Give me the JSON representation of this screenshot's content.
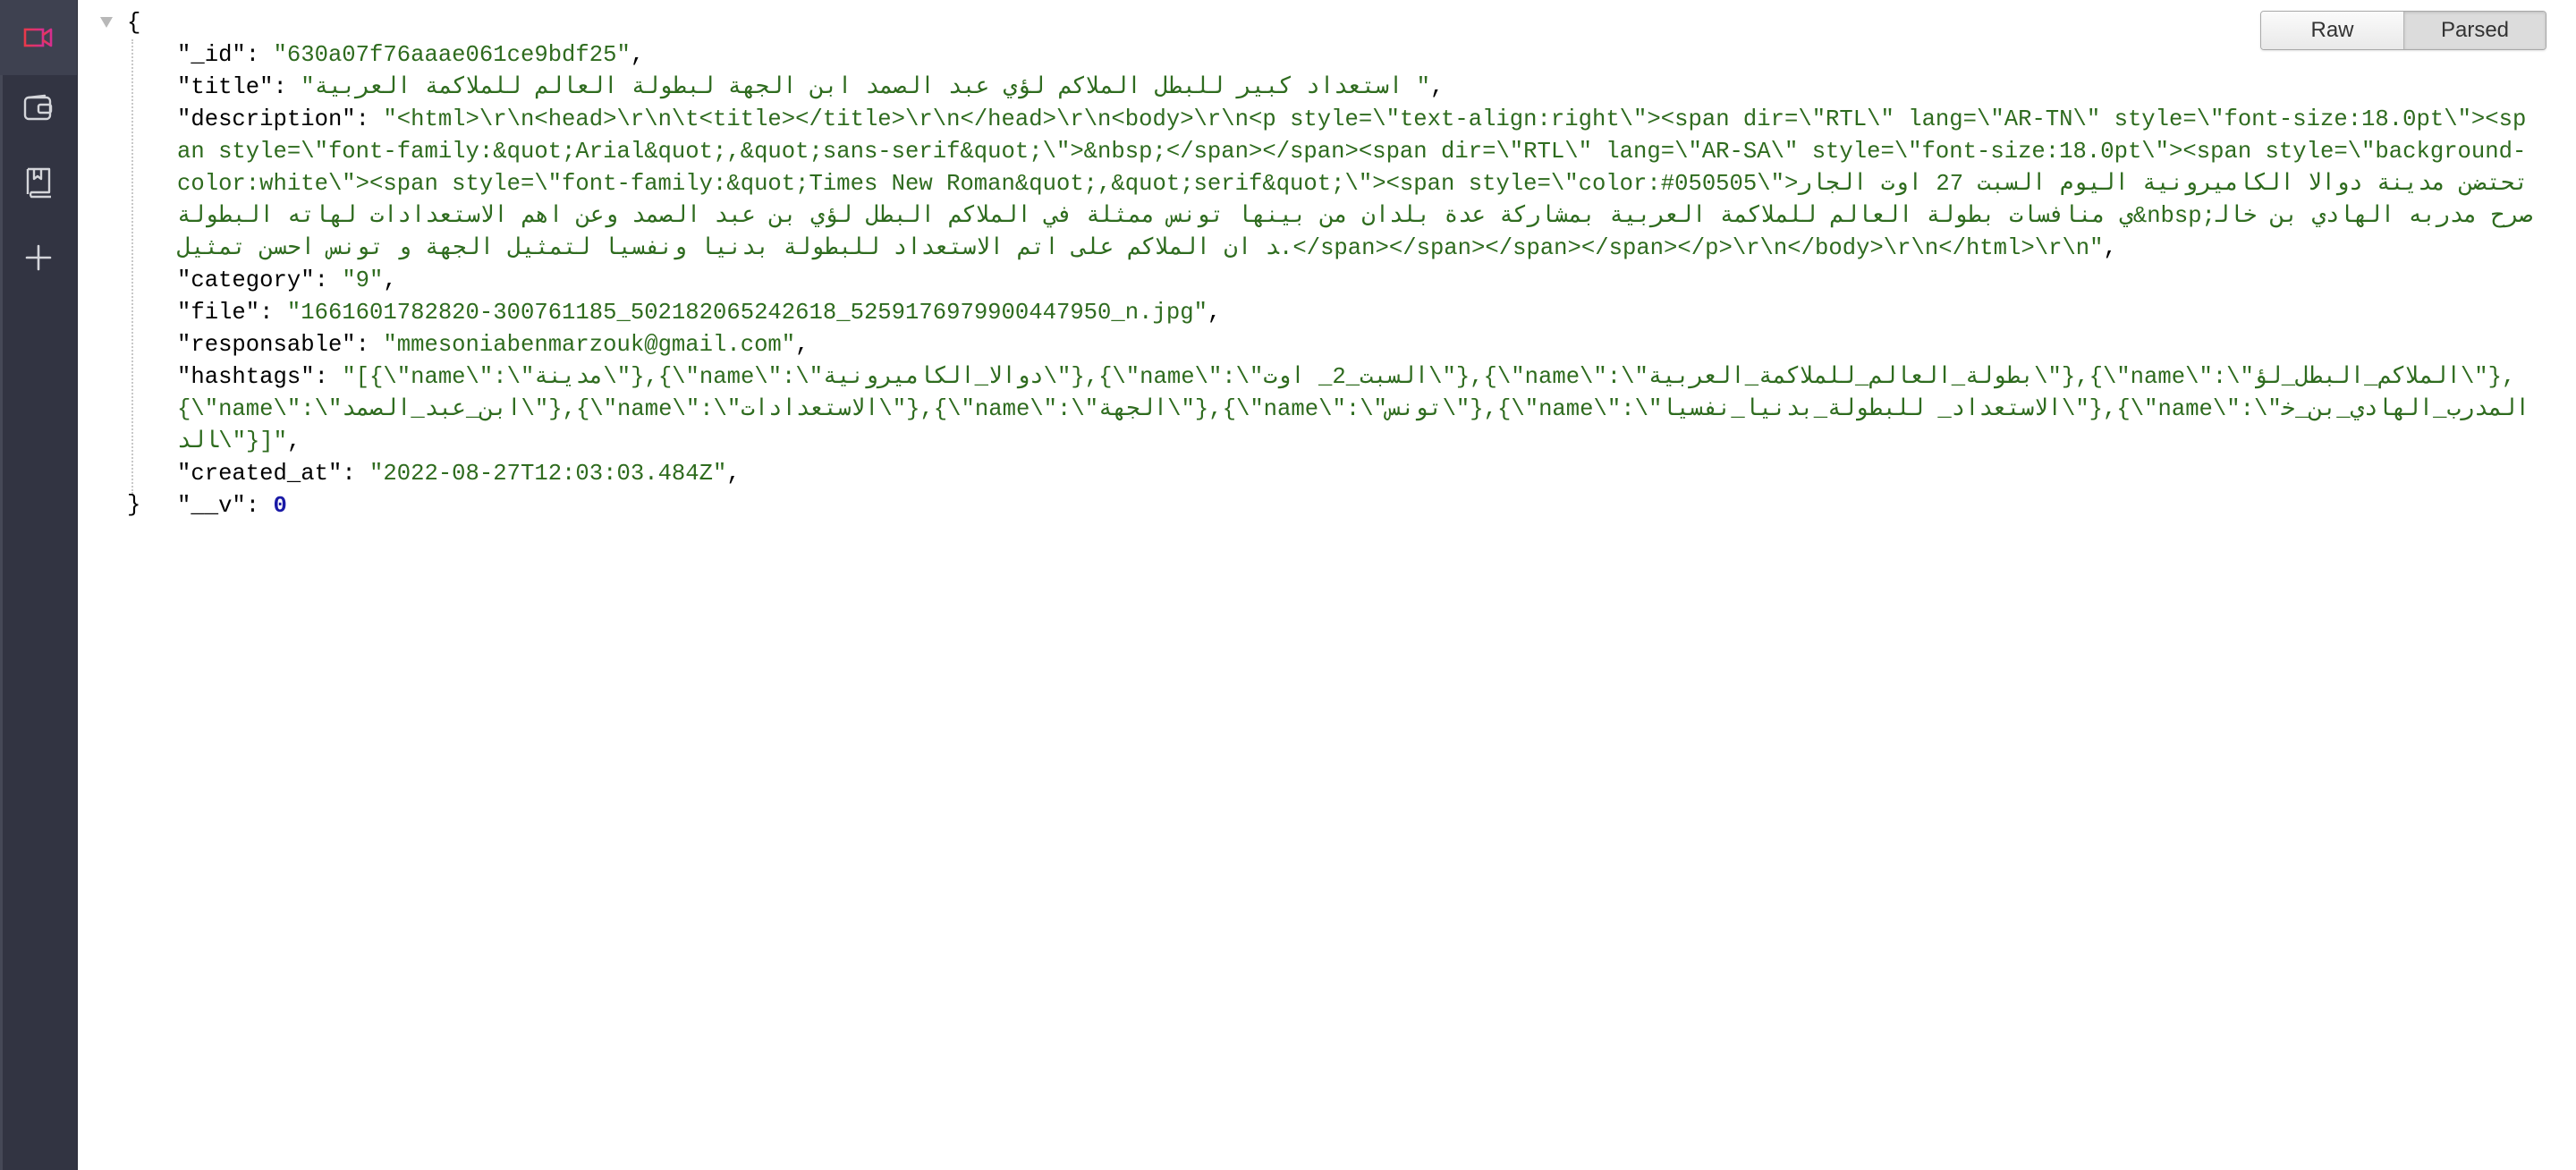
{
  "sidebar": {
    "items": [
      {
        "name": "video",
        "icon": "video-camera-icon",
        "active": true,
        "color": "#e8395a"
      },
      {
        "name": "wallet",
        "icon": "wallet-icon",
        "active": false
      },
      {
        "name": "library",
        "icon": "book-bookmark-icon",
        "active": false
      },
      {
        "name": "add",
        "icon": "plus-icon",
        "active": false
      }
    ]
  },
  "view_toggle": {
    "raw_label": "Raw",
    "parsed_label": "Parsed",
    "selected": "Parsed"
  },
  "colors": {
    "string": "#2e6b1e",
    "number": "#1a1aa6",
    "key": "#000000"
  },
  "json": {
    "open_brace": "{",
    "close_brace": "}",
    "fields": [
      {
        "key": "\"_id\"",
        "type": "string",
        "value": "630a07f76aaae061ce9bdf25"
      },
      {
        "key": "\"title\"",
        "type": "string",
        "value": "استعداد كبير للبطل الملاكم لؤي عبد الصمد ابن الجهة لبطولة العالم للملاكمة العربية "
      },
      {
        "key": "\"description\"",
        "type": "string",
        "value": "<html>\\r\\n<head>\\r\\n\\t<title></title>\\r\\n</head>\\r\\n<body>\\r\\n<p style=\\\"text-align:right\\\"><span dir=\\\"RTL\\\" lang=\\\"AR-TN\\\" style=\\\"font-size:18.0pt\\\"><span style=\\\"font-family:&quot;Arial&quot;,&quot;sans-serif&quot;\\\">&nbsp;</span></span><span dir=\\\"RTL\\\" lang=\\\"AR-SA\\\" style=\\\"font-size:18.0pt\\\"><span style=\\\"background-color:white\\\"><span style=\\\"font-family:&quot;Times New Roman&quot;,&quot;serif&quot;\\\"><span style=\\\"color:#050505\\\">تحتضن مدينة دوالا الكاميرونية اليوم السبت 27 اوت الجاري منافسات بطولة العالم للملاكمة العربية بمشاركة عدة بلدان من بينها تونس ممثلة في الملاكم البطل لؤي بن عبد الصمد وعن اهم الاستعدادات لهاته البطولة&nbsp;صرح مدربه الهادي بن خالد ان الملاكم على اتم الاستعداد للبطولة بدنيا ونفسيا لتمثيل الجهة و تونس احسن تمثيل.</span></span></span></span></p>\\r\\n</body>\\r\\n</html>\\r\\n"
      },
      {
        "key": "\"category\"",
        "type": "string",
        "value": "9"
      },
      {
        "key": "\"file\"",
        "type": "string",
        "value": "1661601782820-300761185_502182065242618_5259176979900447950_n.jpg"
      },
      {
        "key": "\"responsable\"",
        "type": "string",
        "value": "mmesoniabenmarzouk@gmail.com"
      },
      {
        "key": "\"hashtags\"",
        "type": "string",
        "value": "[{\\\"name\\\":\\\"مدينة\\\"},{\\\"name\\\":\\\"دوالا_الكاميرونية\\\"},{\\\"name\\\":\\\"السبت_2_ اوت\\\"},{\\\"name\\\":\\\"بطولة_العالم_للملاكمة_العربية\\\"},{\\\"name\\\":\\\"الملاكم_البطل_لؤ\\\"},{\\\"name\\\":\\\"ابن_عبد_الصمد\\\"},{\\\"name\\\":\\\"الاستعدادات\\\"},{\\\"name\\\":\\\"الجهة\\\"},{\\\"name\\\":\\\"تونس\\\"},{\\\"name\\\":\\\"الاستعداد_ للبطولة_بدنيا_نفسيا\\\"},{\\\"name\\\":\\\"المدرب_الهادي_بن_خالد\\\"}]"
      },
      {
        "key": "\"created_at\"",
        "type": "string",
        "value": "2022-08-27T12:03:03.484Z"
      },
      {
        "key": "\"__v\"",
        "type": "number",
        "value": "0"
      }
    ]
  }
}
